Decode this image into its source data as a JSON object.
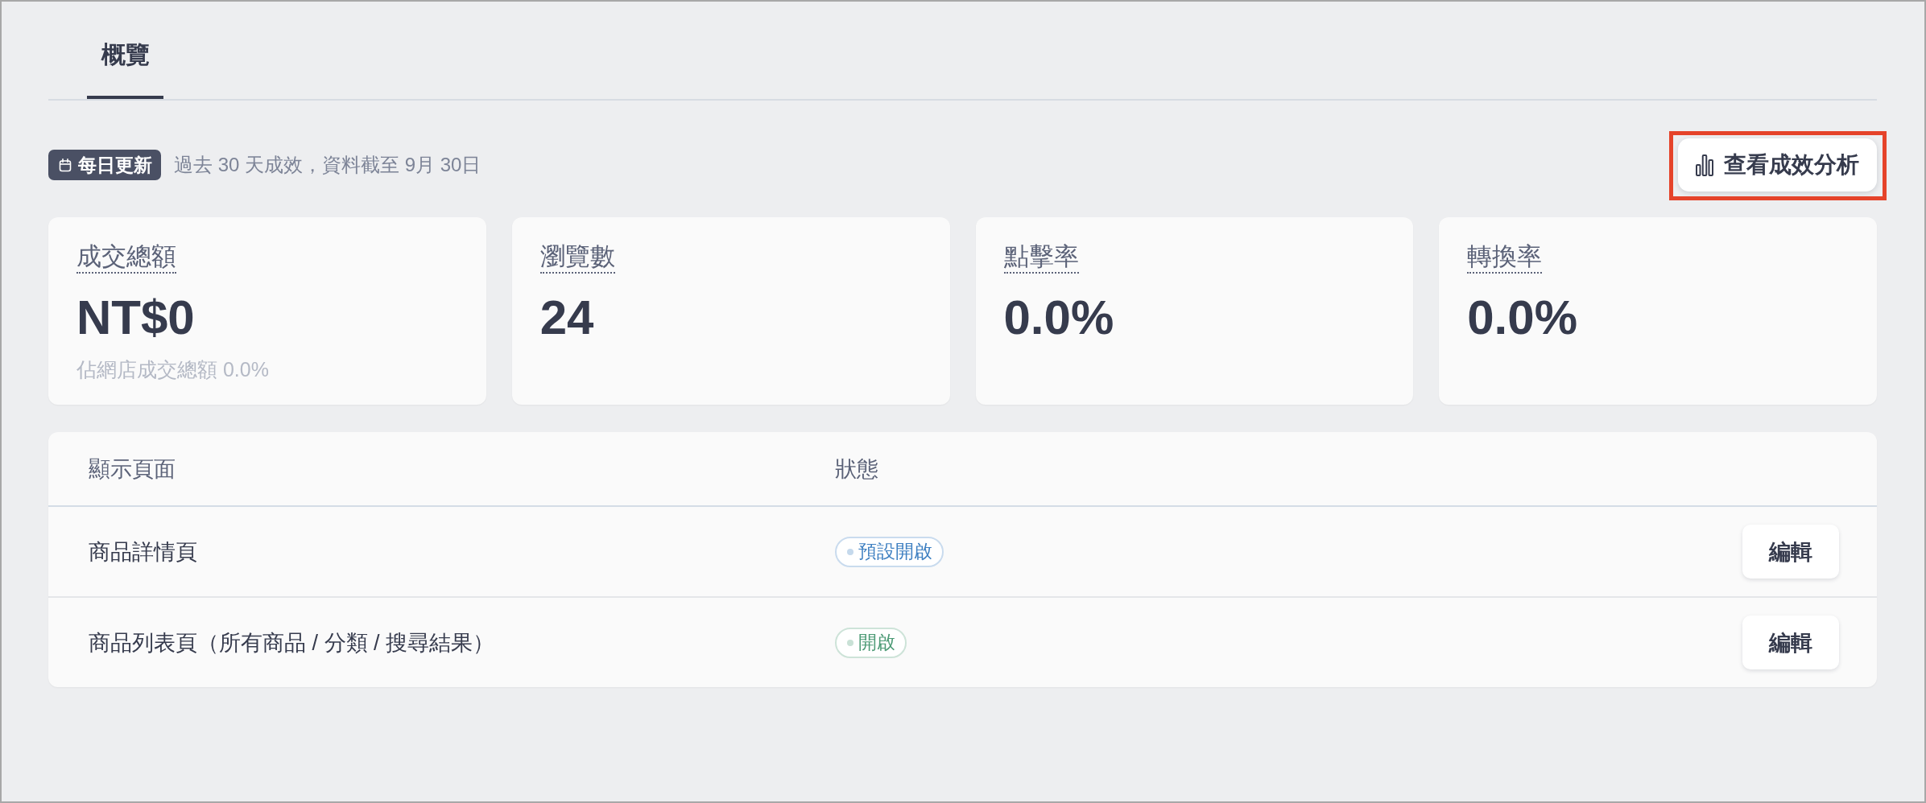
{
  "tabs": [
    {
      "label": "概覽",
      "selected": true
    }
  ],
  "update_bar": {
    "badge": "每日更新",
    "description": "過去 30 天成效，資料截至 9月 30日"
  },
  "analysis_button": {
    "label": "查看成效分析",
    "highlighted": true
  },
  "metrics": [
    {
      "label": "成交總額",
      "value": "NT$0",
      "note": "佔網店成交總額 0.0%"
    },
    {
      "label": "瀏覽數",
      "value": "24"
    },
    {
      "label": "點擊率",
      "value": "0.0%"
    },
    {
      "label": "轉換率",
      "value": "0.0%"
    }
  ],
  "table": {
    "columns": [
      "顯示頁面",
      "狀態"
    ],
    "rows": [
      {
        "page": "商品詳情頁",
        "status": {
          "label": "預設開啟",
          "color": "#3d7fc1"
        },
        "action": "編輯"
      },
      {
        "page": "商品列表頁（所有商品 / 分類 / 搜尋結果）",
        "status": {
          "label": "開啟",
          "color": "#4c9a75"
        },
        "action": "編輯"
      }
    ]
  }
}
